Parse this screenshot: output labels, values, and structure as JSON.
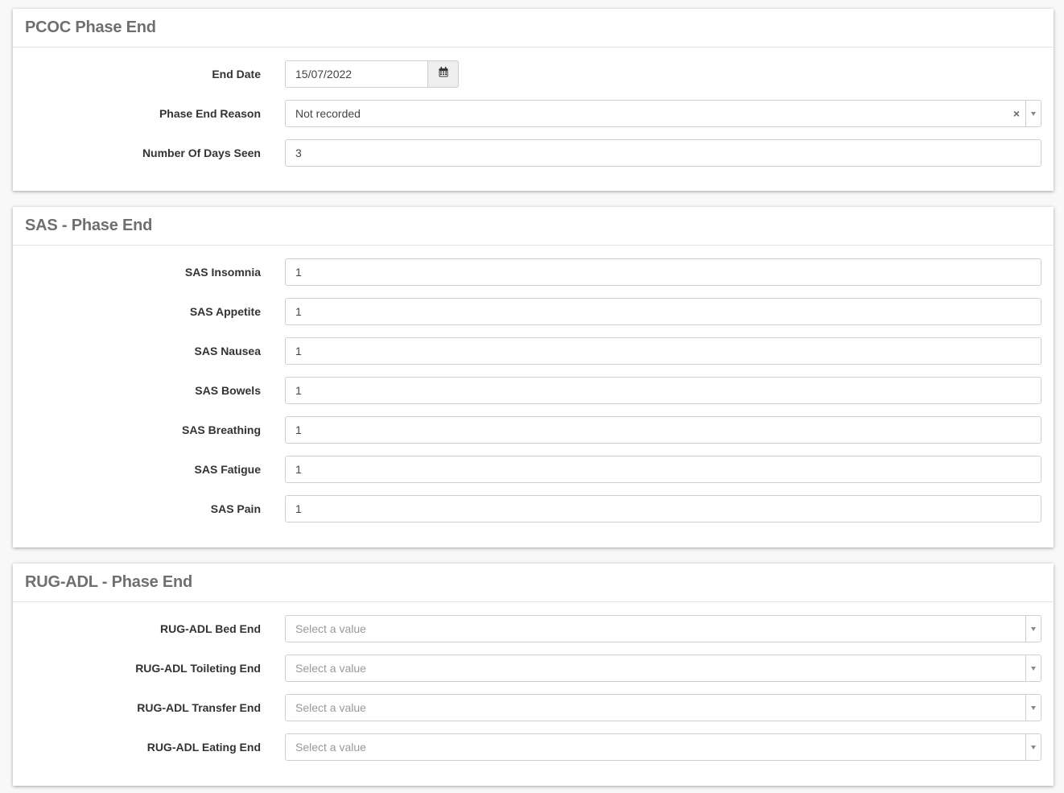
{
  "pcoc": {
    "title": "PCOC Phase End",
    "end_date_label": "End Date",
    "end_date_value": "15/07/2022",
    "reason_label": "Phase End Reason",
    "reason_value": "Not recorded",
    "reason_clear": "×",
    "days_label": "Number Of Days Seen",
    "days_value": "3"
  },
  "sas": {
    "title": "SAS - Phase End",
    "fields": [
      {
        "label": "SAS Insomnia",
        "value": "1"
      },
      {
        "label": "SAS Appetite",
        "value": "1"
      },
      {
        "label": "SAS Nausea",
        "value": "1"
      },
      {
        "label": "SAS Bowels",
        "value": "1"
      },
      {
        "label": "SAS Breathing",
        "value": "1"
      },
      {
        "label": "SAS Fatigue",
        "value": "1"
      },
      {
        "label": "SAS Pain",
        "value": "1"
      }
    ]
  },
  "rug": {
    "title": "RUG-ADL - Phase End",
    "fields": [
      {
        "label": "RUG-ADL Bed End",
        "placeholder": "Select a value"
      },
      {
        "label": "RUG-ADL Toileting End",
        "placeholder": "Select a value"
      },
      {
        "label": "RUG-ADL Transfer End",
        "placeholder": "Select a value"
      },
      {
        "label": "RUG-ADL Eating End",
        "placeholder": "Select a value"
      }
    ]
  },
  "icons": {
    "calendar": "calendar-icon",
    "dropdown": "chevron-down-icon",
    "clear": "close-icon"
  }
}
